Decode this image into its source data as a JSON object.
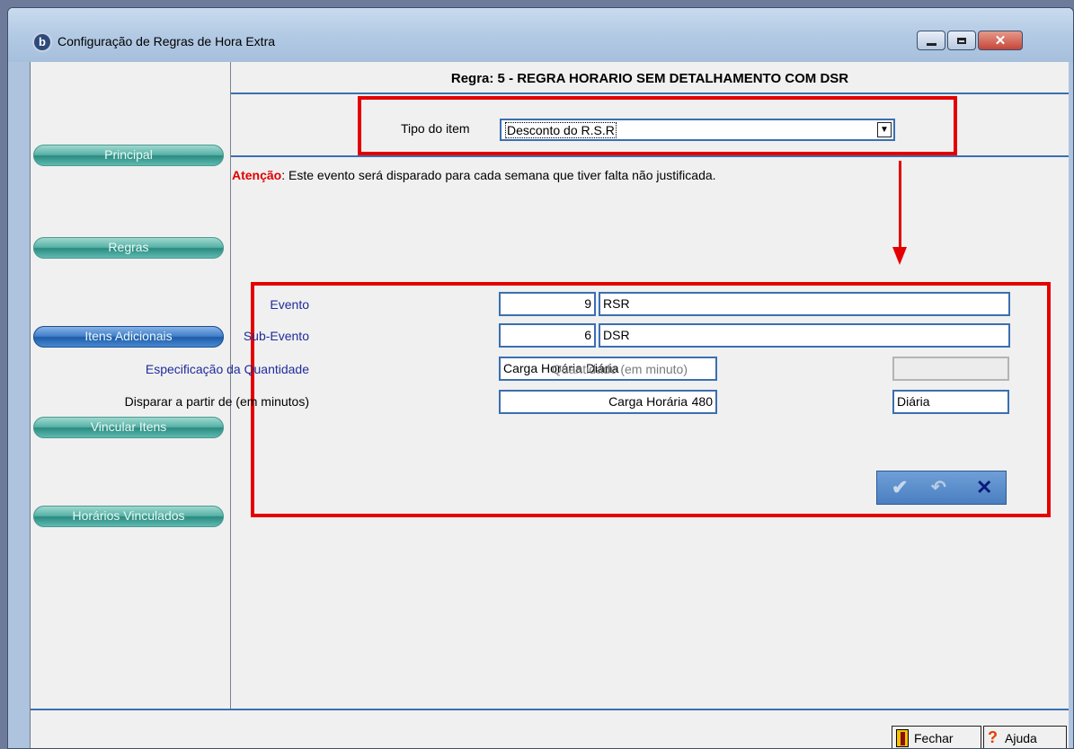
{
  "window": {
    "title": "Configuração de Regras de Hora Extra",
    "icon_glyph": "b",
    "controls": {
      "close_glyph": "✕"
    }
  },
  "sidebar": {
    "items": [
      {
        "label": "Principal",
        "active": false
      },
      {
        "label": "Regras",
        "active": false
      },
      {
        "label": "Itens Adicionais",
        "active": true
      },
      {
        "label": "Vincular Itens",
        "active": false
      },
      {
        "label": "Horários Vinculados",
        "active": false
      }
    ]
  },
  "rule": {
    "title": "Regra: 5 - REGRA HORARIO SEM DETALHAMENTO COM DSR"
  },
  "tipo": {
    "label": "Tipo do item",
    "value": "Desconto do R.S.R",
    "dropdown_glyph": "▼"
  },
  "attention": {
    "prefix": "Atenção",
    "message": ": Este evento será disparado para cada semana que tiver falta não justificada."
  },
  "form": {
    "evento": {
      "label": "Evento",
      "code": "9",
      "name": "RSR"
    },
    "sub_evento": {
      "label": "Sub-Evento",
      "code": "6",
      "name": "DSR"
    },
    "especificacao": {
      "label": "Especificação da Quantidade",
      "value": "Carga Horária Diária"
    },
    "quantidade": {
      "label": "Quantidade (em minuto)",
      "value": ""
    },
    "disparar": {
      "label": "Disparar a partir de (em minutos)",
      "value": "480"
    },
    "carga_horaria": {
      "label": "Carga Horária",
      "value": "Diária"
    }
  },
  "toolbar": {
    "confirm_glyph": "✔",
    "undo_glyph": "↶",
    "cancel_glyph": "✕"
  },
  "footer": {
    "close_label": "Fechar",
    "help_label": "Ajuda",
    "help_glyph": "?"
  },
  "colors": {
    "accent": "#3b6fb0",
    "highlight": "#e50000",
    "side_active": "#2f6fbf",
    "side_inactive": "#43a095"
  }
}
